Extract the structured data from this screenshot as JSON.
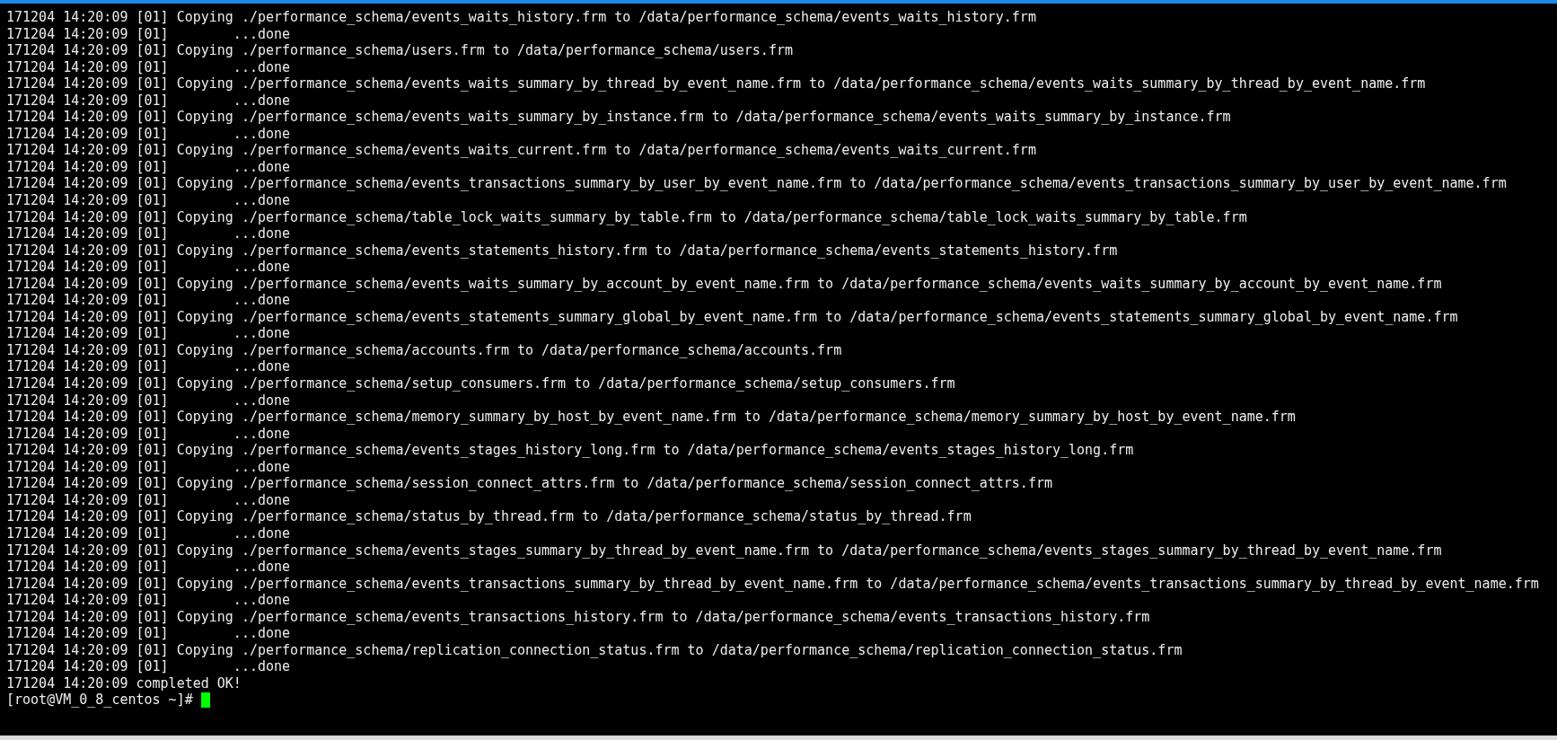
{
  "terminal": {
    "lines": [
      "171204 14:20:09 [01] Copying ./performance_schema/events_waits_history.frm to /data/performance_schema/events_waits_history.frm",
      "171204 14:20:09 [01]        ...done",
      "171204 14:20:09 [01] Copying ./performance_schema/users.frm to /data/performance_schema/users.frm",
      "171204 14:20:09 [01]        ...done",
      "171204 14:20:09 [01] Copying ./performance_schema/events_waits_summary_by_thread_by_event_name.frm to /data/performance_schema/events_waits_summary_by_thread_by_event_name.frm",
      "171204 14:20:09 [01]        ...done",
      "171204 14:20:09 [01] Copying ./performance_schema/events_waits_summary_by_instance.frm to /data/performance_schema/events_waits_summary_by_instance.frm",
      "171204 14:20:09 [01]        ...done",
      "171204 14:20:09 [01] Copying ./performance_schema/events_waits_current.frm to /data/performance_schema/events_waits_current.frm",
      "171204 14:20:09 [01]        ...done",
      "171204 14:20:09 [01] Copying ./performance_schema/events_transactions_summary_by_user_by_event_name.frm to /data/performance_schema/events_transactions_summary_by_user_by_event_name.frm",
      "171204 14:20:09 [01]        ...done",
      "171204 14:20:09 [01] Copying ./performance_schema/table_lock_waits_summary_by_table.frm to /data/performance_schema/table_lock_waits_summary_by_table.frm",
      "171204 14:20:09 [01]        ...done",
      "171204 14:20:09 [01] Copying ./performance_schema/events_statements_history.frm to /data/performance_schema/events_statements_history.frm",
      "171204 14:20:09 [01]        ...done",
      "171204 14:20:09 [01] Copying ./performance_schema/events_waits_summary_by_account_by_event_name.frm to /data/performance_schema/events_waits_summary_by_account_by_event_name.frm",
      "171204 14:20:09 [01]        ...done",
      "171204 14:20:09 [01] Copying ./performance_schema/events_statements_summary_global_by_event_name.frm to /data/performance_schema/events_statements_summary_global_by_event_name.frm",
      "171204 14:20:09 [01]        ...done",
      "171204 14:20:09 [01] Copying ./performance_schema/accounts.frm to /data/performance_schema/accounts.frm",
      "171204 14:20:09 [01]        ...done",
      "171204 14:20:09 [01] Copying ./performance_schema/setup_consumers.frm to /data/performance_schema/setup_consumers.frm",
      "171204 14:20:09 [01]        ...done",
      "171204 14:20:09 [01] Copying ./performance_schema/memory_summary_by_host_by_event_name.frm to /data/performance_schema/memory_summary_by_host_by_event_name.frm",
      "171204 14:20:09 [01]        ...done",
      "171204 14:20:09 [01] Copying ./performance_schema/events_stages_history_long.frm to /data/performance_schema/events_stages_history_long.frm",
      "171204 14:20:09 [01]        ...done",
      "171204 14:20:09 [01] Copying ./performance_schema/session_connect_attrs.frm to /data/performance_schema/session_connect_attrs.frm",
      "171204 14:20:09 [01]        ...done",
      "171204 14:20:09 [01] Copying ./performance_schema/status_by_thread.frm to /data/performance_schema/status_by_thread.frm",
      "171204 14:20:09 [01]        ...done",
      "171204 14:20:09 [01] Copying ./performance_schema/events_stages_summary_by_thread_by_event_name.frm to /data/performance_schema/events_stages_summary_by_thread_by_event_name.frm",
      "171204 14:20:09 [01]        ...done",
      "171204 14:20:09 [01] Copying ./performance_schema/events_transactions_summary_by_thread_by_event_name.frm to /data/performance_schema/events_transactions_summary_by_thread_by_event_name.frm",
      "171204 14:20:09 [01]        ...done",
      "171204 14:20:09 [01] Copying ./performance_schema/events_transactions_history.frm to /data/performance_schema/events_transactions_history.frm",
      "171204 14:20:09 [01]        ...done",
      "171204 14:20:09 [01] Copying ./performance_schema/replication_connection_status.frm to /data/performance_schema/replication_connection_status.frm",
      "171204 14:20:09 [01]        ...done",
      "171204 14:20:09 completed OK!"
    ],
    "prompt": "[root@VM_0_8_centos ~]#"
  }
}
